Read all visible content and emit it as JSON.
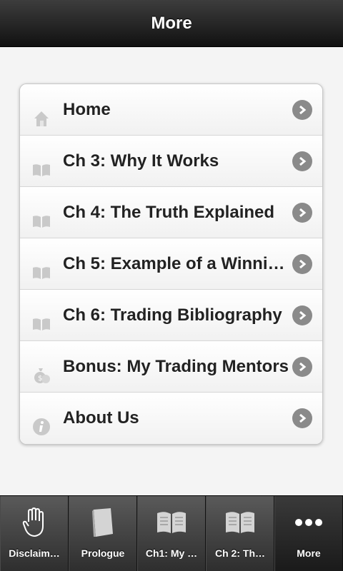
{
  "header": {
    "title": "More"
  },
  "list": {
    "items": [
      {
        "label": "Home",
        "icon": "home-icon"
      },
      {
        "label": "Ch 3: Why It Works",
        "icon": "book-icon"
      },
      {
        "label": "Ch 4: The Truth Explained",
        "icon": "book-icon"
      },
      {
        "label": "Ch 5: Example of a Winnin…",
        "icon": "book-icon"
      },
      {
        "label": "Ch 6: Trading Bibliography",
        "icon": "book-icon"
      },
      {
        "label": "Bonus: My Trading Mentors",
        "icon": "money-bag-icon"
      },
      {
        "label": "About Us",
        "icon": "info-icon"
      }
    ]
  },
  "navbar": {
    "tabs": [
      {
        "label": "Disclaim…",
        "icon": "hand-icon"
      },
      {
        "label": "Prologue",
        "icon": "book-closed-icon"
      },
      {
        "label": "Ch1: My …",
        "icon": "open-book-icon"
      },
      {
        "label": "Ch 2: Th…",
        "icon": "open-book-icon"
      },
      {
        "label": "More",
        "icon": "more-dots-icon"
      }
    ]
  },
  "colors": {
    "header_bg": "#1a1a1a",
    "arrow_bg": "#8a8a8a",
    "text": "#222222"
  }
}
